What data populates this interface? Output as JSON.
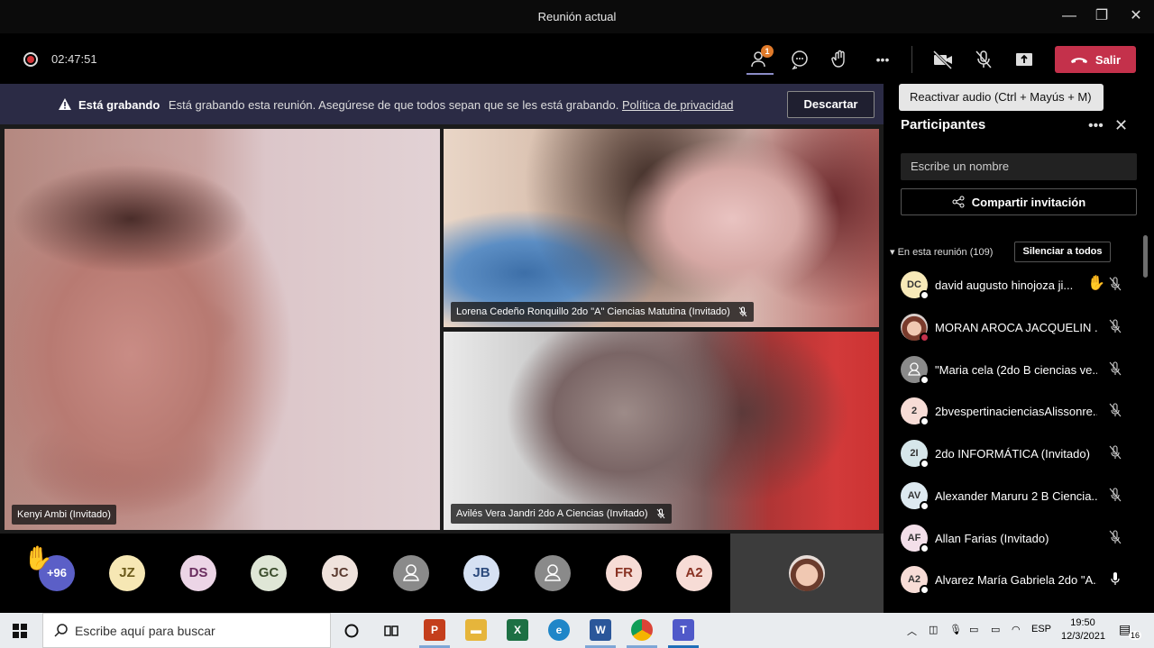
{
  "window": {
    "title": "Reunión actual",
    "minimize_glyph": "—",
    "maximize_glyph": "❐",
    "close_glyph": "✕"
  },
  "toolbar": {
    "timer": "02:47:51",
    "participants_badge": "1",
    "leave_label": "Salir",
    "more_glyph": "•••"
  },
  "tooltip": {
    "text": "Reactivar audio (Ctrl + Mayús + M)"
  },
  "banner": {
    "title": "Está grabando",
    "message": "Está grabando esta reunión. Asegúrese de que todos sepan que se les está grabando.",
    "link": "Política de privacidad",
    "dismiss_label": "Descartar"
  },
  "videos": [
    {
      "name": "Kenyi Ambi (Invitado)"
    },
    {
      "name": "Lorena Cedeño Ronquillo 2do \"A\" Ciencias Matutina (Invitado)"
    },
    {
      "name": "Avilés Vera Jandri 2do A Ciencias (Invitado)"
    }
  ],
  "strip": {
    "more_count": "+96",
    "avatars": [
      {
        "initials": "JZ",
        "bg": "#f6e7b4",
        "fg": "#6b5a1a"
      },
      {
        "initials": "DS",
        "bg": "#ecd5e6",
        "fg": "#6a2e5f"
      },
      {
        "initials": "GC",
        "bg": "#dfe6d6",
        "fg": "#3d4e2e"
      },
      {
        "initials": "JC",
        "bg": "#efe2dc",
        "fg": "#5b3b30"
      },
      {
        "initials": "",
        "bg": "#8a8a8a",
        "fg": "#fff"
      },
      {
        "initials": "JB",
        "bg": "#d6e1f3",
        "fg": "#2c4a7c"
      },
      {
        "initials": "",
        "bg": "#8a8a8a",
        "fg": "#fff"
      },
      {
        "initials": "FR",
        "bg": "#f7dcd6",
        "fg": "#8a3324"
      },
      {
        "initials": "A2",
        "bg": "#f7dcd6",
        "fg": "#8a3324"
      }
    ]
  },
  "panel": {
    "title": "Participantes",
    "search_placeholder": "Escribe un nombre",
    "invite_label": "Compartir invitación",
    "section_label": "En esta reunión (109)",
    "mute_all_label": "Silenciar a todos",
    "participants": [
      {
        "initials": "DC",
        "name": "david augusto hinojoza ji...",
        "bg": "#f7e9b8",
        "hand": true,
        "mic": "muted"
      },
      {
        "initials": "",
        "name": "MORAN AROCA JACQUELIN ...",
        "bg": "photo",
        "hand": false,
        "mic": "muted"
      },
      {
        "initials": "",
        "name": "\"Maria cela (2do B ciencias ve...",
        "bg": "#8a8a8a",
        "hand": false,
        "mic": "muted"
      },
      {
        "initials": "2",
        "name": "2bvespertinacienciasAlissonre...",
        "bg": "#f7dcd6",
        "hand": false,
        "mic": "muted"
      },
      {
        "initials": "2I",
        "name": "2do INFORMÁTICA (Invitado)",
        "bg": "#d6e6ea",
        "hand": false,
        "mic": "muted"
      },
      {
        "initials": "AV",
        "name": "Alexander Maruru 2 B Ciencia...",
        "bg": "#dde9f0",
        "hand": false,
        "mic": "muted"
      },
      {
        "initials": "AF",
        "name": "Allan Farias (Invitado)",
        "bg": "#f3dfe9",
        "hand": false,
        "mic": "muted"
      },
      {
        "initials": "A2",
        "name": "Alvarez María Gabriela 2do \"A...",
        "bg": "#f7dcd6",
        "hand": false,
        "mic": "on"
      }
    ]
  },
  "taskbar": {
    "search_placeholder": "Escribe aquí para buscar",
    "language": "ESP",
    "time": "19:50",
    "date": "12/3/2021",
    "notifications": "16"
  }
}
